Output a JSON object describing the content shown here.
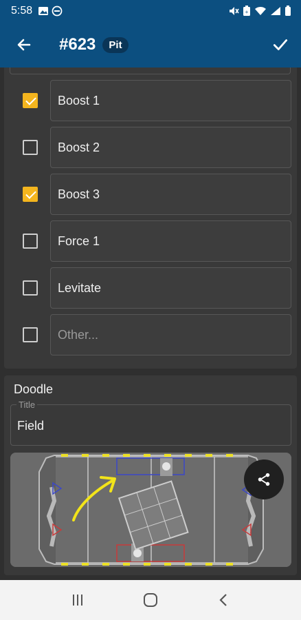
{
  "status_bar": {
    "time": "5:58"
  },
  "app_bar": {
    "title": "#623",
    "badge": "Pit"
  },
  "checklist": [
    {
      "label": "Boost 1",
      "checked": true
    },
    {
      "label": "Boost 2",
      "checked": false
    },
    {
      "label": "Boost 3",
      "checked": true
    },
    {
      "label": "Force 1",
      "checked": false
    },
    {
      "label": "Levitate",
      "checked": false
    }
  ],
  "other_row": {
    "placeholder": "Other...",
    "checked": false
  },
  "doodle": {
    "heading": "Doodle",
    "title_label": "Title",
    "title_value": "Field"
  },
  "colors": {
    "app_bar": "#0c4f80",
    "checkbox_checked": "#f4b51e",
    "doodle_stroke": "#f2e41a"
  }
}
